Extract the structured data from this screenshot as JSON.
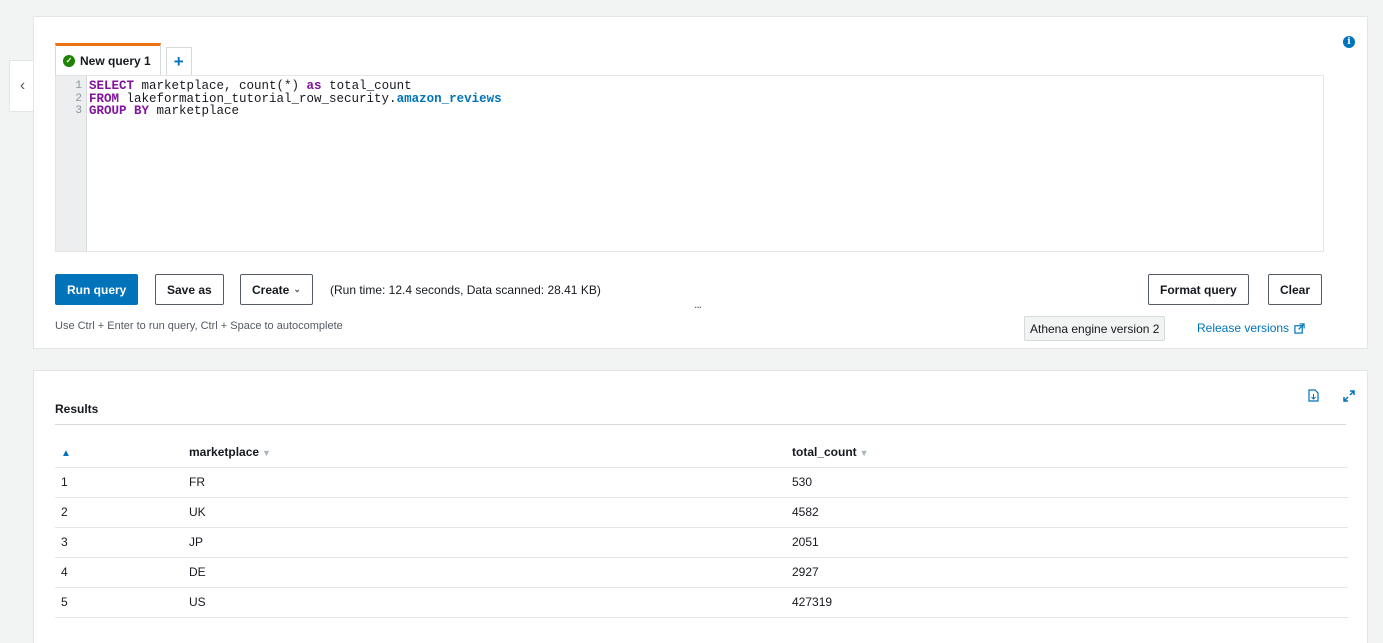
{
  "editor": {
    "tab_label": "New query 1",
    "add_tab_label": "+",
    "line_numbers": [
      "1",
      "2",
      "3"
    ],
    "lines": [
      {
        "kw1": "SELECT",
        "t1": " marketplace, count(*) ",
        "kw2": "as",
        "t2": " total_count"
      },
      {
        "kw1": "FROM",
        "t1": " lakeformation_tutorial_row_security.",
        "tbl": "amazon_reviews"
      },
      {
        "kw1": "GROUP BY",
        "t1": " marketplace"
      }
    ]
  },
  "toolbar": {
    "run_label": "Run query",
    "save_label": "Save as",
    "create_label": "Create",
    "run_stats": "(Run time: 12.4 seconds, Data scanned: 28.41 KB)",
    "ellipsis": "...",
    "format_label": "Format query",
    "clear_label": "Clear",
    "hint": "Use Ctrl + Enter to run query, Ctrl + Space to autocomplete",
    "engine_version": "Athena engine version 2",
    "release_link": "Release versions"
  },
  "icons": {
    "collapse": "chevron-left-icon",
    "info": "info-icon",
    "tab_status": "check-circle-icon",
    "download": "download-csv-icon",
    "expand": "expand-icon",
    "external": "external-link-icon"
  },
  "results": {
    "title": "Results",
    "columns": [
      "marketplace",
      "total_count"
    ],
    "rows": [
      {
        "index": "1",
        "marketplace": "FR",
        "total_count": "530"
      },
      {
        "index": "2",
        "marketplace": "UK",
        "total_count": "4582"
      },
      {
        "index": "3",
        "marketplace": "JP",
        "total_count": "2051"
      },
      {
        "index": "4",
        "marketplace": "DE",
        "total_count": "2927"
      },
      {
        "index": "5",
        "marketplace": "US",
        "total_count": "427319"
      }
    ]
  },
  "colors": {
    "accent": "#0073bb",
    "tab_active": "#ec7211",
    "success": "#1d8102",
    "keyword": "#80149b"
  }
}
